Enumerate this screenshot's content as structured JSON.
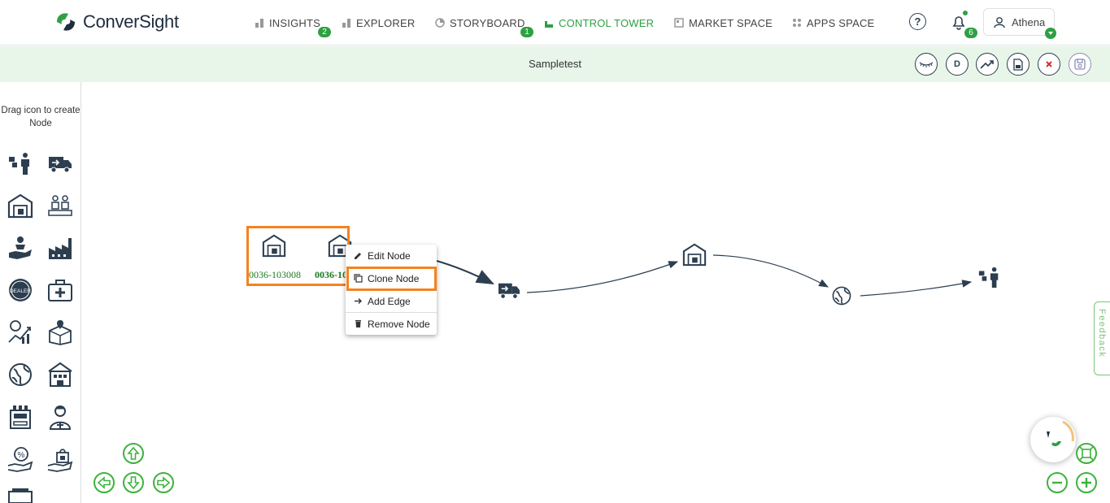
{
  "brand": {
    "name": "ConverSight"
  },
  "nav": [
    {
      "label": "INSIGHTS",
      "badge": "2"
    },
    {
      "label": "EXPLORER",
      "badge": ""
    },
    {
      "label": "STORYBOARD",
      "badge": "1"
    },
    {
      "label": "CONTROL TOWER",
      "badge": ""
    },
    {
      "label": "MARKET SPACE",
      "badge": ""
    },
    {
      "label": "APPS SPACE",
      "badge": ""
    }
  ],
  "notifications": {
    "count": "6"
  },
  "user": {
    "name": "Athena"
  },
  "page": {
    "title": "Sampletest"
  },
  "toolbar": {
    "d_label": "D"
  },
  "sidebar": {
    "hint": "Drag icon to create Node"
  },
  "nodes": [
    {
      "label": "0036-103008"
    },
    {
      "label": "0036-10"
    }
  ],
  "context_menu": {
    "items": [
      "Edit Node",
      "Clone Node",
      "Add Edge",
      "Remove Node"
    ]
  },
  "feedback": {
    "label": "Feedback"
  },
  "colors": {
    "accent": "#2ea043",
    "highlight": "#f5821f",
    "ink": "#2c3e50"
  }
}
